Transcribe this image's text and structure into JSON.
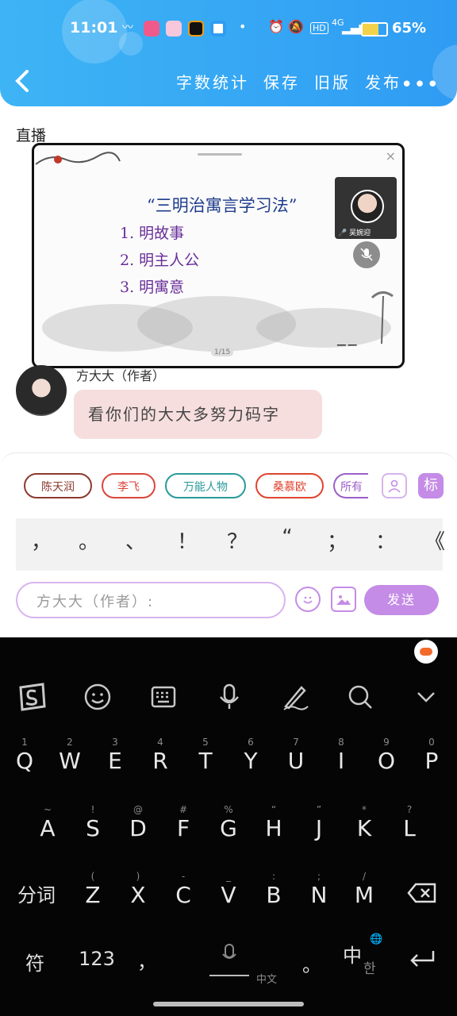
{
  "status_bar": {
    "time": "11:01",
    "battery": "65%",
    "battery_level": 0.65,
    "network": "4G",
    "hd": "HD"
  },
  "header": {
    "back_icon": "chevron-left-icon",
    "actions": [
      "字数统计",
      "保存",
      "旧版",
      "发布"
    ],
    "more": "•••"
  },
  "live": {
    "section_label": "直播",
    "slide_title": "“三明治寓言学习法”",
    "slide_items": [
      "1. 明故事",
      "2. 明主人公",
      "3. 明寓意"
    ],
    "presenter_name": "吴婉迎",
    "page_indicator": "1/15",
    "close_symbol": "×"
  },
  "message": {
    "sender": "方大大（作者）",
    "text": "看你们的大大多努力码字"
  },
  "tags": [
    {
      "label": "陈天润",
      "color": "#8b3a2e"
    },
    {
      "label": "李飞",
      "color": "#d9463a"
    },
    {
      "label": "万能人物",
      "color": "#2a9a9a"
    },
    {
      "label": "桑慕欧",
      "color": "#e0442f"
    },
    {
      "label": "所有",
      "color": "#9b5fc9"
    }
  ],
  "mark_button": "标",
  "punctuation": [
    "，",
    "。",
    "、",
    "！",
    "？",
    "“",
    "；",
    "：",
    "《"
  ],
  "input": {
    "placeholder": "方大大（作者）:"
  },
  "send_label": "发送",
  "keyboard": {
    "row1": [
      [
        "1",
        "Q"
      ],
      [
        "2",
        "W"
      ],
      [
        "3",
        "E"
      ],
      [
        "4",
        "R"
      ],
      [
        "5",
        "T"
      ],
      [
        "6",
        "Y"
      ],
      [
        "7",
        "U"
      ],
      [
        "8",
        "I"
      ],
      [
        "9",
        "O"
      ],
      [
        "0",
        "P"
      ]
    ],
    "row2": [
      [
        "~",
        "A"
      ],
      [
        "!",
        "S"
      ],
      [
        "@",
        "D"
      ],
      [
        "#",
        "F"
      ],
      [
        "%",
        "G"
      ],
      [
        "“",
        "H"
      ],
      [
        "”",
        "J"
      ],
      [
        "*",
        "K"
      ],
      [
        "?",
        "L"
      ]
    ],
    "row3": [
      [
        "(",
        "Z"
      ],
      [
        ")",
        "X"
      ],
      [
        "-",
        "C"
      ],
      [
        "_",
        "V"
      ],
      [
        ":",
        "B"
      ],
      [
        ";",
        "N"
      ],
      [
        "/",
        "M"
      ]
    ],
    "fenci": "分词",
    "fu": "符",
    "num": "123",
    "comma": "，",
    "space_label": "中文",
    "period": "。",
    "lang_main": "中",
    "lang_sub": "한"
  },
  "colors": {
    "accent": "#c48be7",
    "header_blue": "#2f9cf3",
    "message_bubble": "#f6dede"
  }
}
